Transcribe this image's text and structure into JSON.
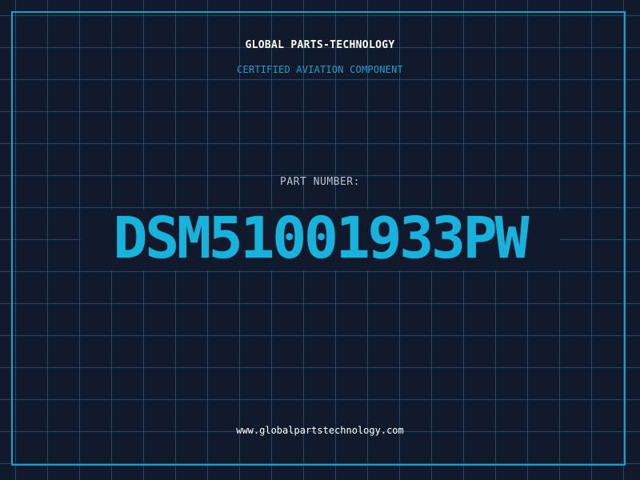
{
  "header": {
    "company": "GLOBAL PARTS-TECHNOLOGY",
    "tagline": "CERTIFIED AVIATION COMPONENT"
  },
  "part": {
    "label": "PART NUMBER:",
    "number": "DSM51001933PW"
  },
  "footer": {
    "url": "www.globalpartstechnology.com"
  },
  "colors": {
    "background": "#111a2c",
    "grid": "#286e8c",
    "accent": "#18b3dc",
    "frame": "#1aa0c8",
    "text": "#ffffff",
    "label": "#b8c2d0"
  }
}
